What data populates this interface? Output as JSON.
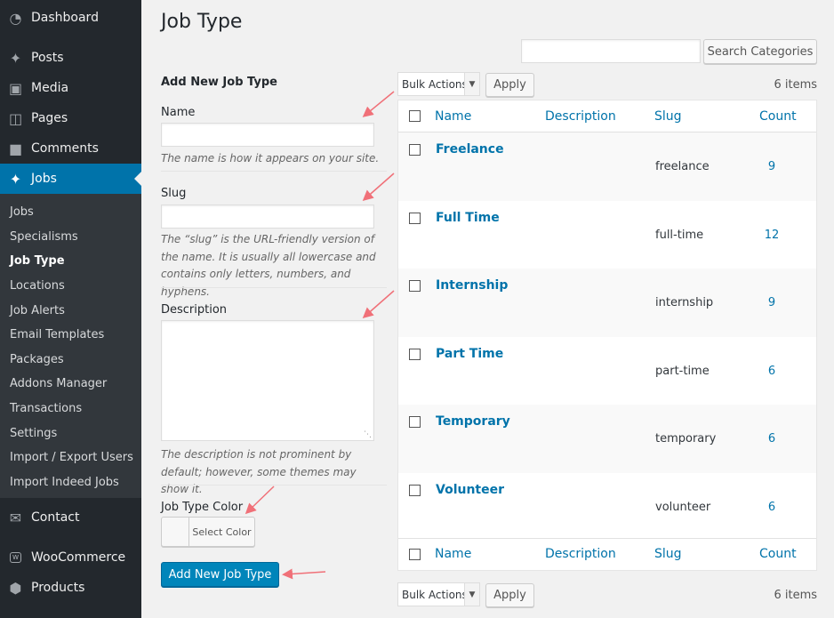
{
  "sidebar": {
    "top_items": [
      {
        "label": "Dashboard",
        "icon": "dashboard-icon"
      },
      {
        "label": "Posts",
        "icon": "pin-icon"
      },
      {
        "label": "Media",
        "icon": "media-icon"
      },
      {
        "label": "Pages",
        "icon": "pages-icon"
      },
      {
        "label": "Comments",
        "icon": "comment-icon"
      },
      {
        "label": "Jobs",
        "icon": "pin-icon"
      }
    ],
    "submenu": [
      "Jobs",
      "Specialisms",
      "Job Type",
      "Locations",
      "Job Alerts",
      "Email Templates",
      "Packages",
      "Addons Manager",
      "Transactions",
      "Settings",
      "Import / Export Users",
      "Import Indeed Jobs"
    ],
    "bottom_items": [
      {
        "label": "Contact",
        "icon": "mail-icon"
      },
      {
        "label": "WooCommerce",
        "icon": "woo-icon"
      },
      {
        "label": "Products",
        "icon": "box-icon"
      }
    ],
    "active_color": "#0073aa"
  },
  "page": {
    "title": "Job Type",
    "search_button": "Search Categories"
  },
  "form": {
    "heading": "Add New Job Type",
    "name_label": "Name",
    "name_help": "The name is how it appears on your site.",
    "slug_label": "Slug",
    "slug_help": "The “slug” is the URL-friendly version of the name. It is usually all lowercase and contains only letters, numbers, and hyphens.",
    "description_label": "Description",
    "description_help": "The description is not prominent by default; however, some themes may show it.",
    "color_label": "Job Type Color",
    "color_button": "Select Color",
    "submit": "Add New Job Type"
  },
  "table": {
    "bulk_actions": "Bulk Actions",
    "apply": "Apply",
    "items_count": "6 items",
    "columns": [
      "Name",
      "Description",
      "Slug",
      "Count"
    ],
    "rows": [
      {
        "name": "Freelance",
        "description": "",
        "slug": "freelance",
        "count": "9"
      },
      {
        "name": "Full Time",
        "description": "",
        "slug": "full-time",
        "count": "12"
      },
      {
        "name": "Internship",
        "description": "",
        "slug": "internship",
        "count": "9"
      },
      {
        "name": "Part Time",
        "description": "",
        "slug": "part-time",
        "count": "6"
      },
      {
        "name": "Temporary",
        "description": "",
        "slug": "temporary",
        "count": "6"
      },
      {
        "name": "Volunteer",
        "description": "",
        "slug": "volunteer",
        "count": "6"
      }
    ]
  },
  "annotation_color": "#f07078"
}
